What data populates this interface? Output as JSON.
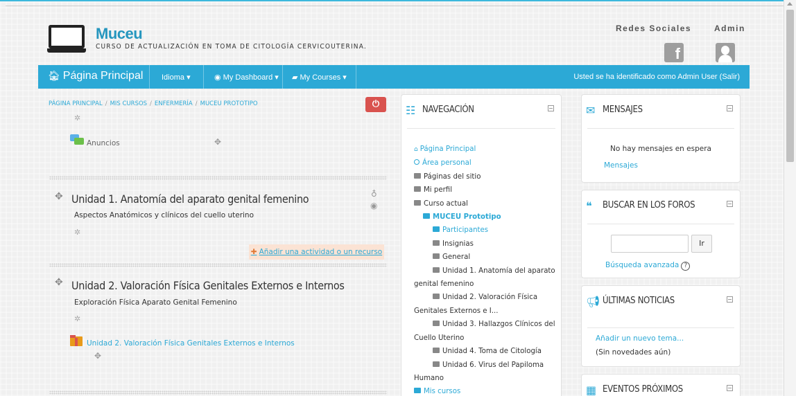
{
  "header": {
    "site_name": "Muceu",
    "tagline": "CURSO DE ACTUALIZACIÓN EN TOMA DE CITOLOGÍA CERVICOUTERINA.",
    "social_label": "Redes Sociales",
    "admin_label": "Admin",
    "facebook_glyph": "f"
  },
  "navbar": {
    "home": "Página Principal",
    "idioma": "Idioma ▾",
    "dashboard": "My Dashboard ▾",
    "courses": "My Courses ▾",
    "user_status": "Usted se ha identificado como Admin User (Salir)"
  },
  "breadcrumb": [
    "PÁGINA PRINCIPAL",
    "MIS CURSOS",
    "ENFERMERÍA",
    "MUCEU PROTOTIPO"
  ],
  "main": {
    "anuncios": "Anuncios",
    "add_activity": "Añadir una actividad o un recurso",
    "sections": [
      {
        "title": "Unidad 1. Anatomía del aparato genital femenino",
        "summary": "Aspectos Anatómicos y clínicos del cuello uterino"
      },
      {
        "title": "Unidad 2. Valoración Física Genitales Externos e Internos",
        "summary": "Exploración Física Aparato Genital Femenino",
        "resource": "Unidad 2. Valoración Física Genitales Externos e Internos"
      }
    ]
  },
  "navigation": {
    "title": "NAVEGACIÓN",
    "items": [
      {
        "label": "Página Principal"
      },
      {
        "label": "Área personal"
      },
      {
        "label": "Páginas del sitio"
      },
      {
        "label": "Mi perfil"
      },
      {
        "label": "Curso actual"
      },
      {
        "label": "MUCEU Prototipo"
      },
      {
        "label": "Participantes"
      },
      {
        "label": "Insignias"
      },
      {
        "label": "General"
      },
      {
        "label": "Unidad 1. Anatomía del aparato",
        "label2": "genital femenino"
      },
      {
        "label": "Unidad 2. Valoración Física",
        "label2": "Genitales Externos e I..."
      },
      {
        "label": "Unidad 3. Hallazgos Clínicos del",
        "label2": "Cuello Uterino"
      },
      {
        "label": "Unidad 4. Toma de Citología"
      },
      {
        "label": "Unidad 6. Virus del Papiloma",
        "label2": "Humano"
      },
      {
        "label": "Mis cursos"
      }
    ]
  },
  "messages": {
    "title": "MENSAJES",
    "empty": "No hay mensajes en espera",
    "link": "Mensajes"
  },
  "forum_search": {
    "title": "BUSCAR EN LOS FOROS",
    "input_value": "",
    "button": "Ir",
    "advanced": "Búsqueda avanzada",
    "help": "?"
  },
  "news": {
    "title": "ÚLTIMAS NOTICIAS",
    "add_topic": "Añadir un nuevo tema...",
    "none": "(Sin novedades aún)"
  },
  "events": {
    "title": "EVENTOS PRÓXIMOS"
  },
  "colors": {
    "accent": "#2ca9d6",
    "danger": "#d9534f",
    "highlight": "#fbe3d4"
  },
  "icons": [
    "laptop-logo-icon",
    "facebook-icon",
    "user-icon",
    "home-icon",
    "dashboard-icon",
    "briefcase-icon",
    "power-icon",
    "gear-icon",
    "move-icon",
    "forum-icon",
    "folder-icon",
    "sitemap-icon",
    "envelope-icon",
    "comments-icon",
    "bullhorn-icon",
    "calendar-icon",
    "eye-icon",
    "lightbulb-icon"
  ]
}
